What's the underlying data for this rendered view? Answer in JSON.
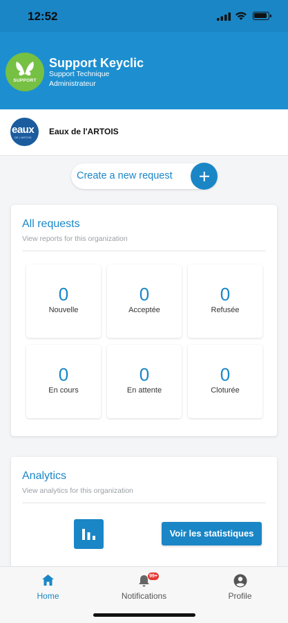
{
  "status": {
    "time": "12:52"
  },
  "header": {
    "user_name": "Support Keyclic",
    "role": "Support Technique",
    "rank": "Administrateur",
    "avatar_text": "SUPPORT"
  },
  "organization": {
    "logo_text": "eaux",
    "logo_subtext": "DE L'ARTOIS",
    "name": "Eaux de l'ARTOIS"
  },
  "create_request": {
    "label": "Create a new request"
  },
  "requests_card": {
    "title": "All requests",
    "subtitle": "View reports for this organization",
    "tiles": [
      {
        "count": "0",
        "label": "Nouvelle"
      },
      {
        "count": "0",
        "label": "Acceptée"
      },
      {
        "count": "0",
        "label": "Refusée"
      },
      {
        "count": "0",
        "label": "En cours"
      },
      {
        "count": "0",
        "label": "En attente"
      },
      {
        "count": "0",
        "label": "Cloturée"
      }
    ]
  },
  "analytics_card": {
    "title": "Analytics",
    "subtitle": "View analytics for this organization",
    "button_label": "Voir les statistiques"
  },
  "tabbar": {
    "tabs": [
      {
        "label": "Home",
        "active": true
      },
      {
        "label": "Notifications",
        "badge": "99+"
      },
      {
        "label": "Profile"
      }
    ]
  },
  "colors": {
    "primary": "#1a86c6",
    "header": "#1d8fd0",
    "avatar_green": "#76c043",
    "badge_red": "#e53935"
  }
}
